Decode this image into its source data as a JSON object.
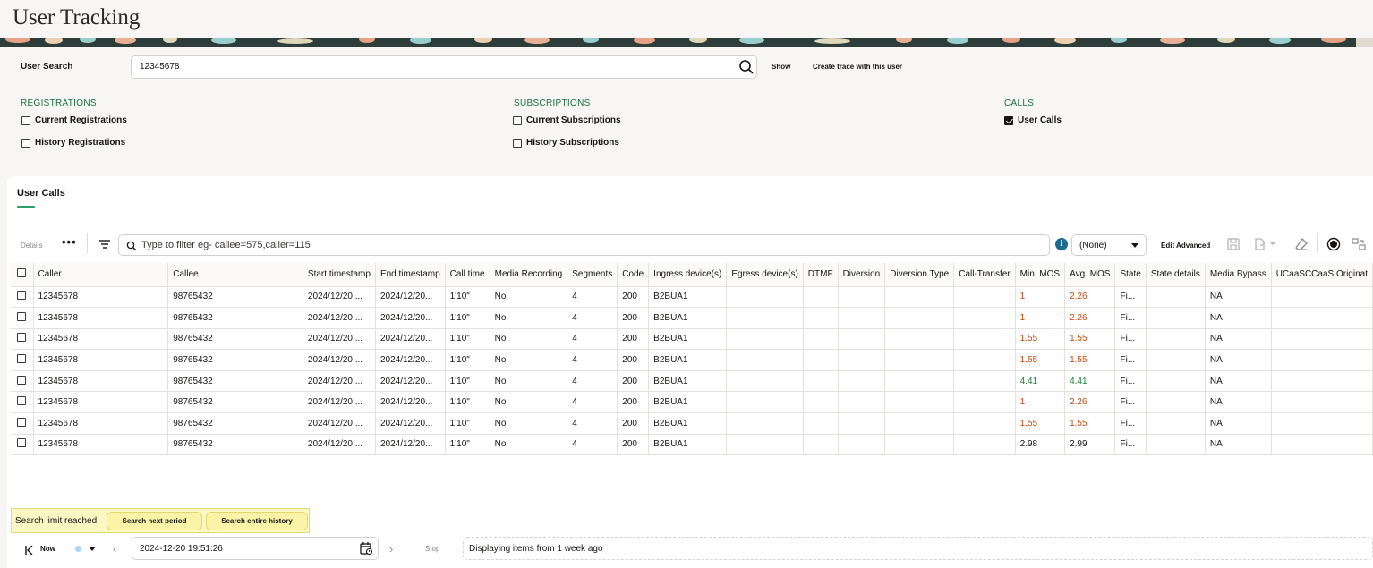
{
  "app": {
    "title": "User Tracking"
  },
  "search": {
    "label": "User Search",
    "value": "12345678",
    "show_label": "Show",
    "create_trace_label": "Create trace with this user"
  },
  "sections": {
    "registrations": {
      "title": "REGISTRATIONS",
      "options": [
        {
          "label": "Current Registrations",
          "checked": false
        },
        {
          "label": "History Registrations",
          "checked": false
        }
      ]
    },
    "subscriptions": {
      "title": "SUBSCRIPTIONS",
      "options": [
        {
          "label": "Current Subscriptions",
          "checked": false
        },
        {
          "label": "History Subscriptions",
          "checked": false
        }
      ]
    },
    "calls": {
      "title": "CALLS",
      "options": [
        {
          "label": "User Calls",
          "checked": true
        }
      ]
    }
  },
  "panel": {
    "tab_label": "User Calls",
    "toolbar": {
      "details_label": "Details",
      "more_label": "•••",
      "filter_placeholder": "Type to filter eg- callee=575,caller=115",
      "filter_select_value": "(None)",
      "edit_advanced_label": "Edit Advanced",
      "info_icon": "i"
    },
    "table": {
      "columns": [
        "Caller",
        "Callee",
        "Start timestamp",
        "End timestamp",
        "Call time",
        "Media Recording",
        "Segments",
        "Code",
        "Ingress device(s)",
        "Egress device(s)",
        "DTMF",
        "Diversion",
        "Diversion Type",
        "Call-Transfer",
        "Min. MOS",
        "Avg. MOS",
        "State",
        "State details",
        "Media Bypass",
        "UCaaSCCaaS Originat"
      ],
      "rows": [
        [
          "12345678",
          "98765432",
          "2024/12/20 ...",
          "2024/12/20...",
          "1'10\"",
          "No",
          "4",
          "200",
          "B2BUA1",
          "",
          "",
          "",
          "",
          "",
          "1",
          "2.26",
          "Fi...",
          "",
          "NA",
          ""
        ],
        [
          "12345678",
          "98765432",
          "2024/12/20 ...",
          "2024/12/20...",
          "1'10\"",
          "No",
          "4",
          "200",
          "B2BUA1",
          "",
          "",
          "",
          "",
          "",
          "1",
          "2.26",
          "Fi...",
          "",
          "NA",
          ""
        ],
        [
          "12345678",
          "98765432",
          "2024/12/20 ...",
          "2024/12/20...",
          "1'10\"",
          "No",
          "4",
          "200",
          "B2BUA1",
          "",
          "",
          "",
          "",
          "",
          "1.55",
          "1.55",
          "Fi...",
          "",
          "NA",
          ""
        ],
        [
          "12345678",
          "98765432",
          "2024/12/20 ...",
          "2024/12/20...",
          "1'10\"",
          "No",
          "4",
          "200",
          "B2BUA1",
          "",
          "",
          "",
          "",
          "",
          "1.55",
          "1.55",
          "Fi...",
          "",
          "NA",
          ""
        ],
        [
          "12345678",
          "98765432",
          "2024/12/20 ...",
          "2024/12/20...",
          "1'10\"",
          "No",
          "4",
          "200",
          "B2BUA1",
          "",
          "",
          "",
          "",
          "",
          "4.41",
          "4.41",
          "Fi...",
          "",
          "NA",
          ""
        ],
        [
          "12345678",
          "98765432",
          "2024/12/20 ...",
          "2024/12/20...",
          "1'10\"",
          "No",
          "4",
          "200",
          "B2BUA1",
          "",
          "",
          "",
          "",
          "",
          "1",
          "2.26",
          "Fi...",
          "",
          "NA",
          ""
        ],
        [
          "12345678",
          "98765432",
          "2024/12/20 ...",
          "2024/12/20...",
          "1'10\"",
          "No",
          "4",
          "200",
          "B2BUA1",
          "",
          "",
          "",
          "",
          "",
          "1.55",
          "1.55",
          "Fi...",
          "",
          "NA",
          ""
        ],
        [
          "12345678",
          "98765432",
          "2024/12/20 ...",
          "2024/12/20...",
          "1'10\"",
          "No",
          "4",
          "200",
          "B2BUA1",
          "",
          "",
          "",
          "",
          "",
          "2.98",
          "2.99",
          "Fi...",
          "",
          "NA",
          ""
        ]
      ],
      "mos_colors": {
        "low": "#c54a0f",
        "good": "#1b7e3c",
        "mid": "#161513"
      }
    },
    "limit": {
      "text": "Search limit reached",
      "next_period_label": "Search next period",
      "entire_history_label": "Search entire history"
    },
    "nav": {
      "now_label": "Now",
      "date_value": "2024-12-20 19:51:26",
      "stop_label": "Stop",
      "status_text": "Displaying items from 1 week ago"
    }
  },
  "colors": {
    "accent_green": "#1b6e44",
    "tab_underline": "#2d9e6c",
    "limit_bg": "#fbf8c3"
  }
}
